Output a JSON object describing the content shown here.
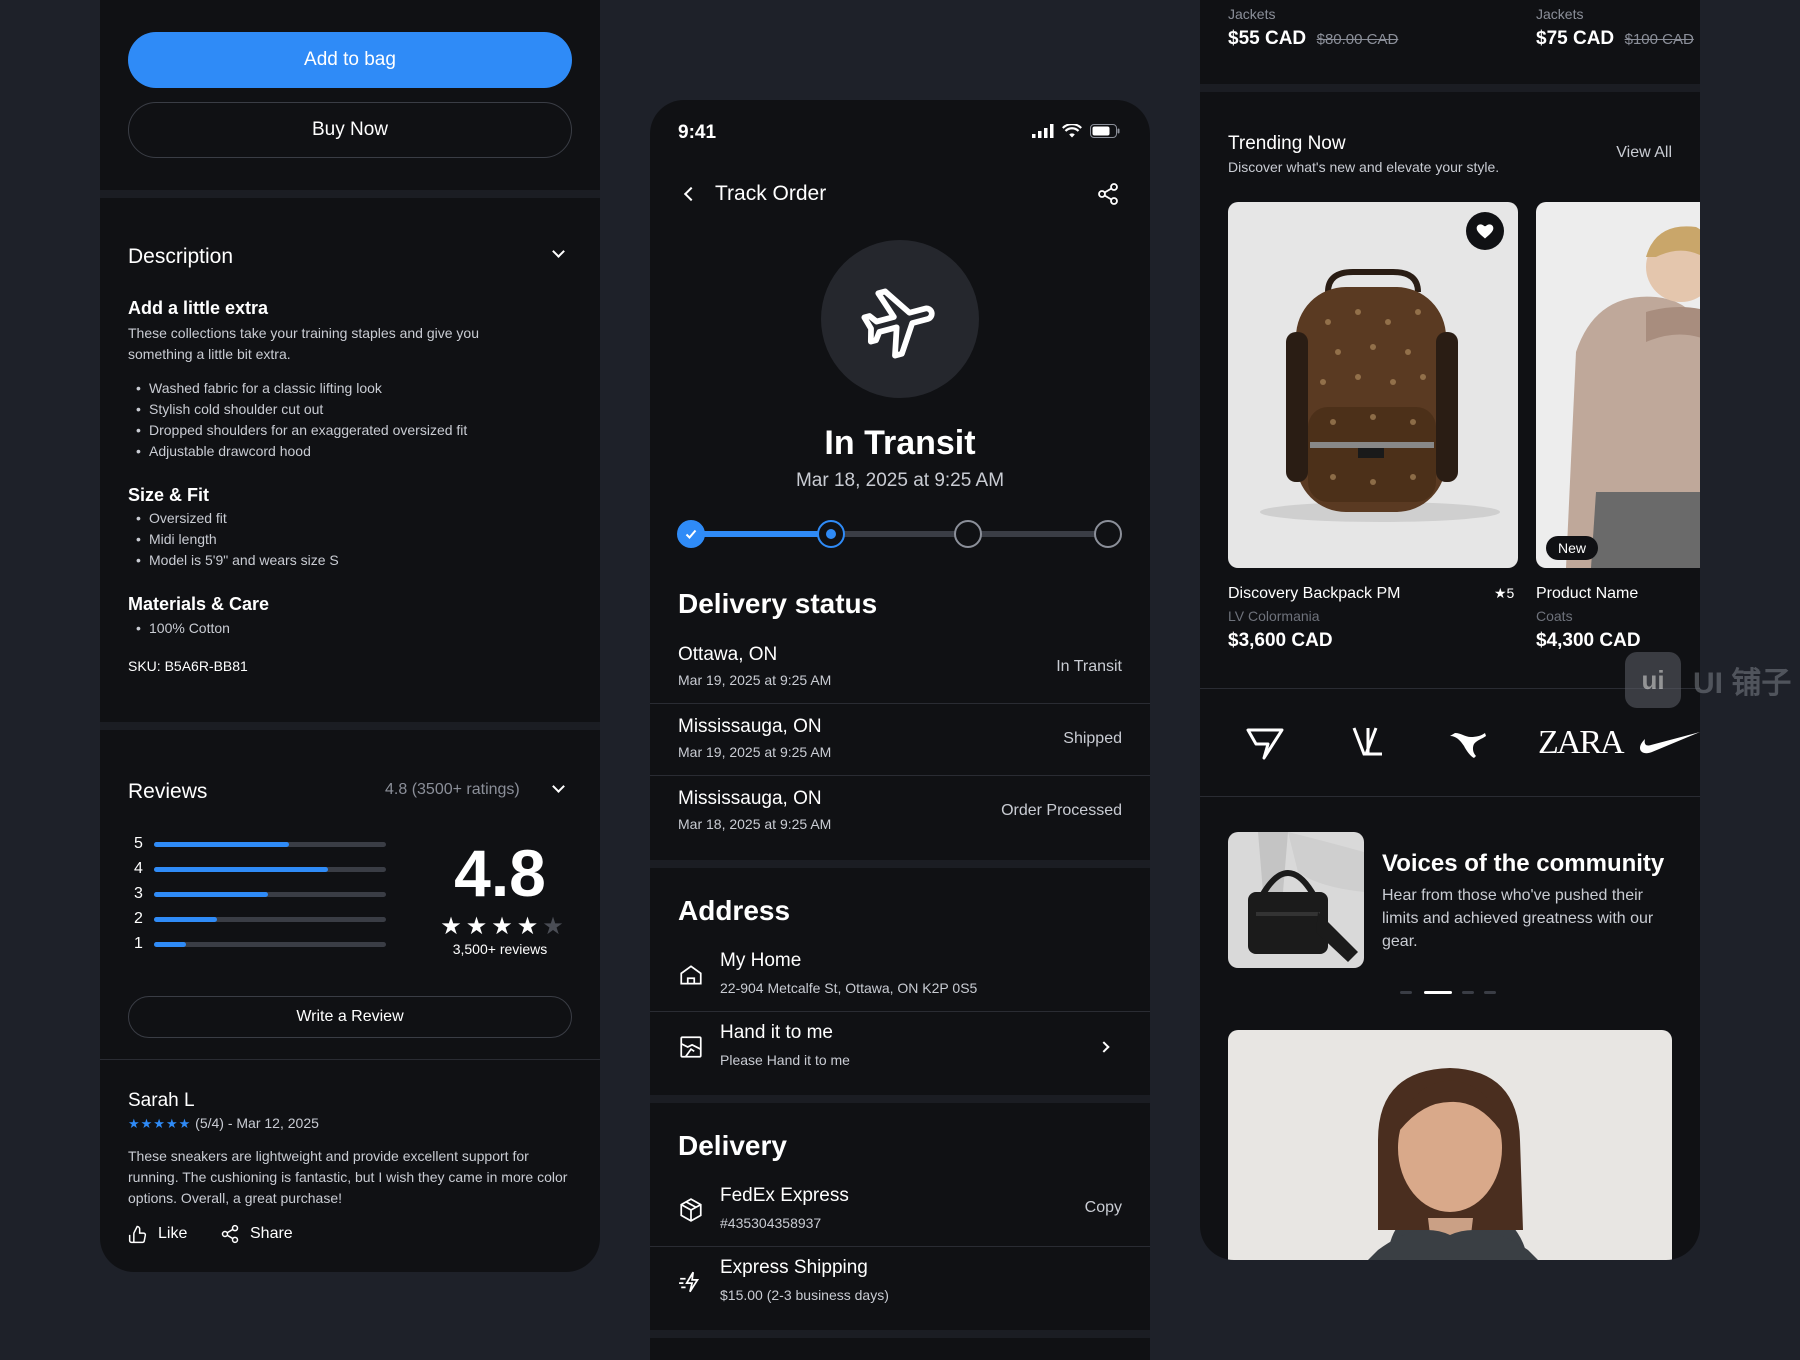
{
  "left": {
    "add_to_bag": "Add to bag",
    "buy_now": "Buy Now",
    "description_title": "Description",
    "extra_title": "Add a little extra",
    "extra_text": "These collections take your training staples and give you something a little bit extra.",
    "features": [
      "Washed fabric for a classic lifting look",
      "Stylish cold shoulder cut out",
      "Dropped shoulders for an exaggerated oversized fit",
      "Adjustable drawcord hood"
    ],
    "size_title": "Size & Fit",
    "size_items": [
      "Oversized fit",
      "Midi length",
      "Model is 5'9\" and wears size S"
    ],
    "materials_title": "Materials & Care",
    "materials_items": [
      "100% Cotton"
    ],
    "sku": "SKU: B5A6R-BB81",
    "reviews_title": "Reviews",
    "reviews_summary": "4.8 (3500+ ratings)",
    "rating_bars": [
      {
        "label": "5",
        "fraction": 0.58
      },
      {
        "label": "4",
        "fraction": 0.75
      },
      {
        "label": "3",
        "fraction": 0.49
      },
      {
        "label": "2",
        "fraction": 0.27
      },
      {
        "label": "1",
        "fraction": 0.14
      }
    ],
    "rating_value": "4.8",
    "rating_stars": 4,
    "rating_count": "3,500+ reviews",
    "write_review": "Write a Review",
    "review": {
      "author": "Sarah L",
      "stars": 5,
      "meta": "(5/4) - Mar 12, 2025",
      "text": "These sneakers are lightweight and provide excellent support for running. The cushioning is fantastic, but I wish they came in more color options. Overall, a great purchase!",
      "like": "Like",
      "share": "Share"
    }
  },
  "mid": {
    "time": "9:41",
    "header_title": "Track Order",
    "status_title": "In Transit",
    "status_date": "Mar 18, 2025 at 9:25 AM",
    "progress": {
      "completed_steps": 1,
      "current_step": 2,
      "total_steps": 4
    },
    "delivery_status_title": "Delivery status",
    "delivery_rows": [
      {
        "city": "Ottawa, ON",
        "date": "Mar 19, 2025 at 9:25 AM",
        "status": "In Transit"
      },
      {
        "city": "Mississauga, ON",
        "date": "Mar 19, 2025 at 9:25 AM",
        "status": "Shipped"
      },
      {
        "city": "Mississauga, ON",
        "date": "Mar 18, 2025 at 9:25 AM",
        "status": "Order Processed"
      }
    ],
    "address_title": "Address",
    "address_home_title": "My Home",
    "address_home_sub": "22-904 Metcalfe St, Ottawa, ON K2P 0S5",
    "address_hand_title": "Hand it to me",
    "address_hand_sub": "Please Hand it to me",
    "delivery_title": "Delivery",
    "carrier_title": "FedEx Express",
    "carrier_sub": "#435304358937",
    "copy_label": "Copy",
    "shipping_title": "Express Shipping",
    "shipping_sub": "$15.00 (2-3 business days)"
  },
  "right": {
    "top_products": [
      {
        "category": "Jackets",
        "price": "$55 CAD",
        "old_price": "$80.00 CAD"
      },
      {
        "category": "Jackets",
        "price": "$75 CAD",
        "old_price": "$100 CAD"
      }
    ],
    "trending_title": "Trending Now",
    "trending_sub": "Discover what's new and elevate your style.",
    "view_all": "View All",
    "products": [
      {
        "name": "Discovery Backpack PM",
        "brand": "LV Colormania",
        "price": "$3,600 CAD",
        "rating": "★5"
      },
      {
        "name": "Product Name",
        "brand": "Coats",
        "price": "$4,300 CAD",
        "badge": "New"
      }
    ],
    "brands": [
      "ZARA"
    ],
    "community_title": "Voices of the community",
    "community_text": "Hear from those who've pushed their limits and achieved greatness with our gear.",
    "watermark": "UI 铺子"
  },
  "colors": {
    "accent": "#2f8bf7",
    "panel": "#101114",
    "background": "#1e2129"
  }
}
